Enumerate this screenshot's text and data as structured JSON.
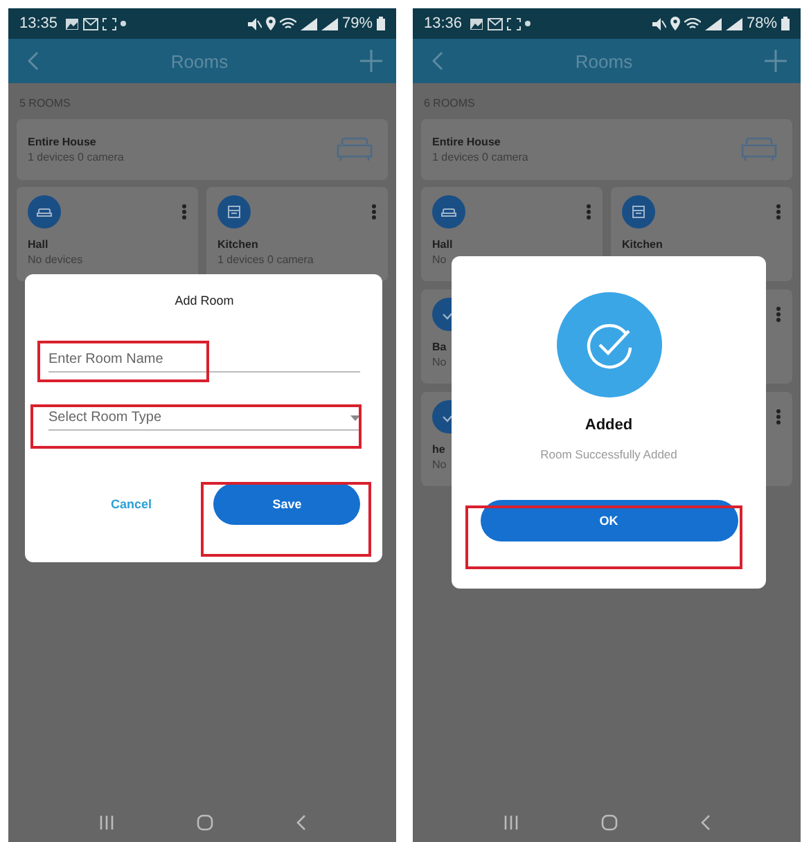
{
  "screens": [
    {
      "status_bar": {
        "time": "13:35",
        "battery": "79%"
      },
      "app_bar": {
        "title": "Rooms"
      },
      "room_count": "5 ROOMS",
      "summary_card": {
        "name": "Entire House",
        "details": "1 devices 0 camera"
      },
      "rooms": [
        {
          "name": "Hall",
          "details": "No devices",
          "kind": "sofa"
        },
        {
          "name": "Kitchen",
          "details": "1 devices 0 camera",
          "kind": "oven"
        }
      ],
      "dialog": {
        "kind": "add_room",
        "title": "Add Room",
        "name_placeholder": "Enter Room Name",
        "type_placeholder": "Select Room Type",
        "cancel": "Cancel",
        "save": "Save"
      }
    },
    {
      "status_bar": {
        "time": "13:36",
        "battery": "78%"
      },
      "app_bar": {
        "title": "Rooms"
      },
      "room_count": "6 ROOMS",
      "summary_card": {
        "name": "Entire House",
        "details": "1 devices 0 camera"
      },
      "rooms": [
        {
          "name": "Hall",
          "details": "No",
          "kind": "sofa"
        },
        {
          "name": "Kitchen",
          "kind": "oven"
        },
        {
          "name": "Ba",
          "details": "No",
          "kind": "check"
        },
        {
          "kind": "blank"
        },
        {
          "name": "he",
          "details": "No",
          "kind": "check"
        },
        {
          "kind": "blank"
        }
      ],
      "dialog": {
        "kind": "success",
        "title": "Added",
        "message": "Room Successfully Added",
        "ok": "OK"
      }
    }
  ]
}
